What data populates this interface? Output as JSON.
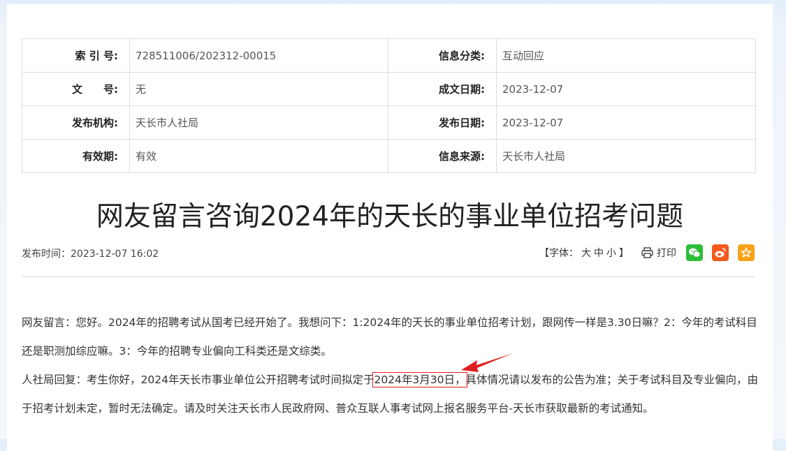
{
  "meta": {
    "rows": [
      {
        "l1": "索 引 号:",
        "v1": "728511006/202312-00015",
        "l2": "信息分类:",
        "v2": "互动回应"
      },
      {
        "l1": "文　　号:",
        "v1": "无",
        "l2": "成文日期:",
        "v2": "2023-12-07"
      },
      {
        "l1": "发布机构:",
        "v1": "天长市人社局",
        "l2": "发布日期:",
        "v2": "2023-12-07"
      },
      {
        "l1": "有效期:",
        "v1": "有效",
        "l2": "信息来源:",
        "v2": "天长市人社局"
      }
    ]
  },
  "article": {
    "title": "网友留言咨询2024年的天长的事业单位招考问题",
    "pub_time": "发布时间：2023-12-07 16:02",
    "font_size_prefix": "【字体：",
    "font_large": "大",
    "font_medium": "中",
    "font_small": "小",
    "font_size_suffix": "】",
    "print_label": "打印",
    "question": "网友留言：您好。2024年的招聘考试从国考已经开始了。我想问下：1:2024年的天长的事业单位招考计划，跟网传一样是3.30日嘛？2：今年的考试科目还是职测加综应嘛。3：今年的招聘专业偏向工科类还是文综类。",
    "reply_before": "人社局回复：考生你好，2024年天长市事业单位公开招聘考试时间拟定于",
    "reply_highlight": "2024年3月30日，",
    "reply_after": "具体情况请以发布的公告为准；关于考试科目及专业偏向，由于招考计划未定，暂时无法确定。请及时关注天长市人民政府网、普众互联人事考试网上报名服务平台-天长市获取最新的考试通知。"
  },
  "colors": {
    "wechat": "#2dbd3a",
    "weibo": "#f35a1e",
    "favorite": "#f7a21b",
    "highlight": "#e02020"
  },
  "icons": [
    "print-icon",
    "wechat-icon",
    "weibo-icon",
    "favorite-star-icon",
    "red-arrow-icon"
  ]
}
